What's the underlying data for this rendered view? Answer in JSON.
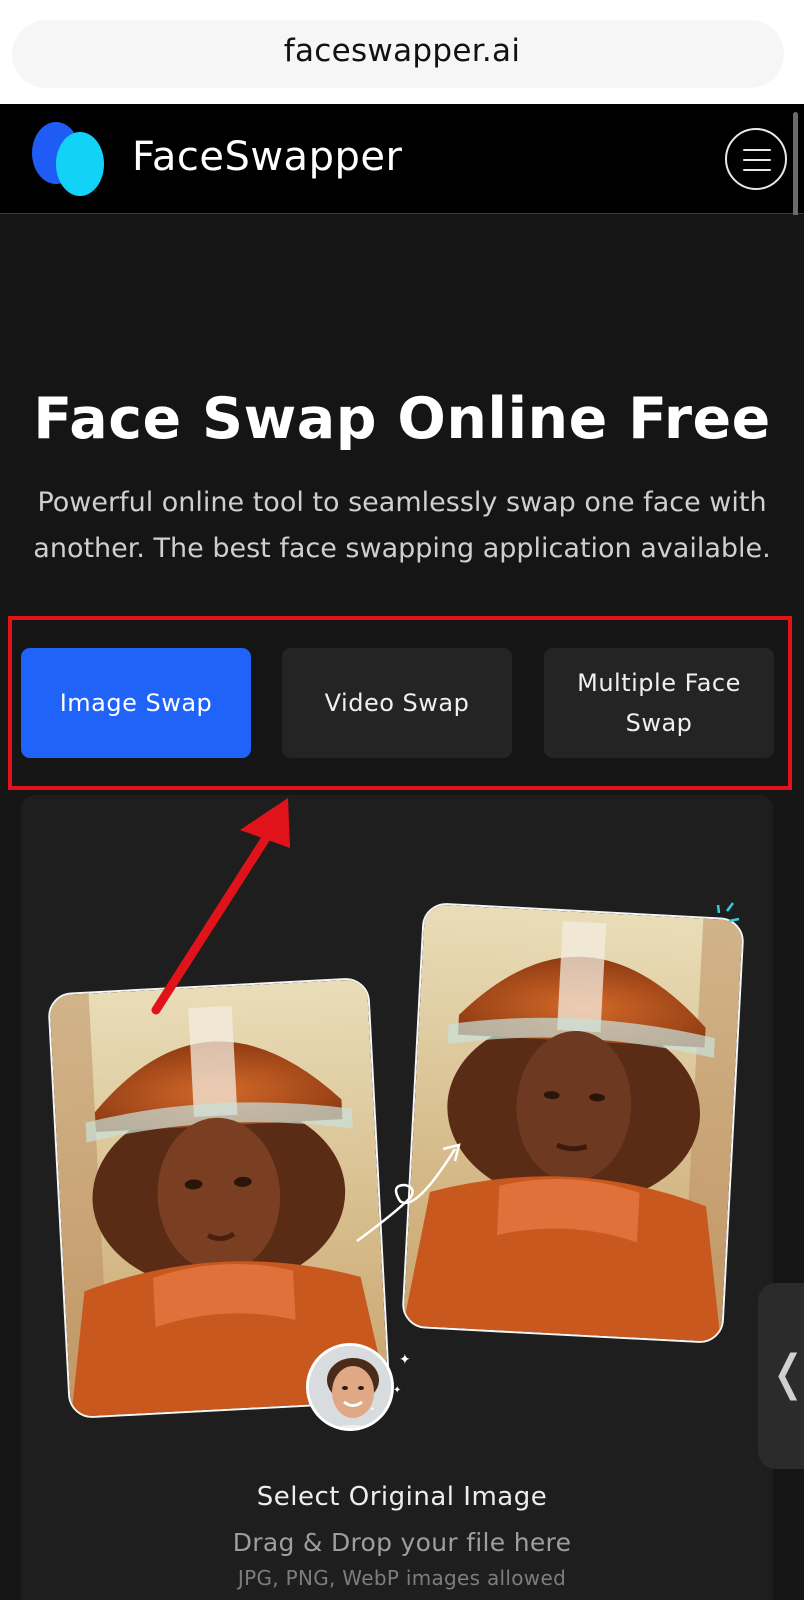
{
  "browser": {
    "url": "faceswapper.ai"
  },
  "header": {
    "brand": "FaceSwapper",
    "menu_icon": "hamburger-menu-icon"
  },
  "hero": {
    "title": "Face Swap Online Free",
    "subtitle": "Powerful online tool to seamlessly swap one face with another. The best face swapping application available."
  },
  "tabs": [
    {
      "label": "Image Swap",
      "active": true
    },
    {
      "label": "Video Swap",
      "active": false
    },
    {
      "label": "Multiple Face Swap",
      "active": false
    }
  ],
  "upload": {
    "title": "Select Original Image",
    "drag_text": "Drag & Drop your file here",
    "formats": "JPG, PNG, WebP images allowed"
  },
  "colors": {
    "accent": "#2063f8",
    "highlight_box": "#e0131a",
    "logo_blue": "#1f5cf6",
    "logo_cyan": "#12d3f7"
  }
}
